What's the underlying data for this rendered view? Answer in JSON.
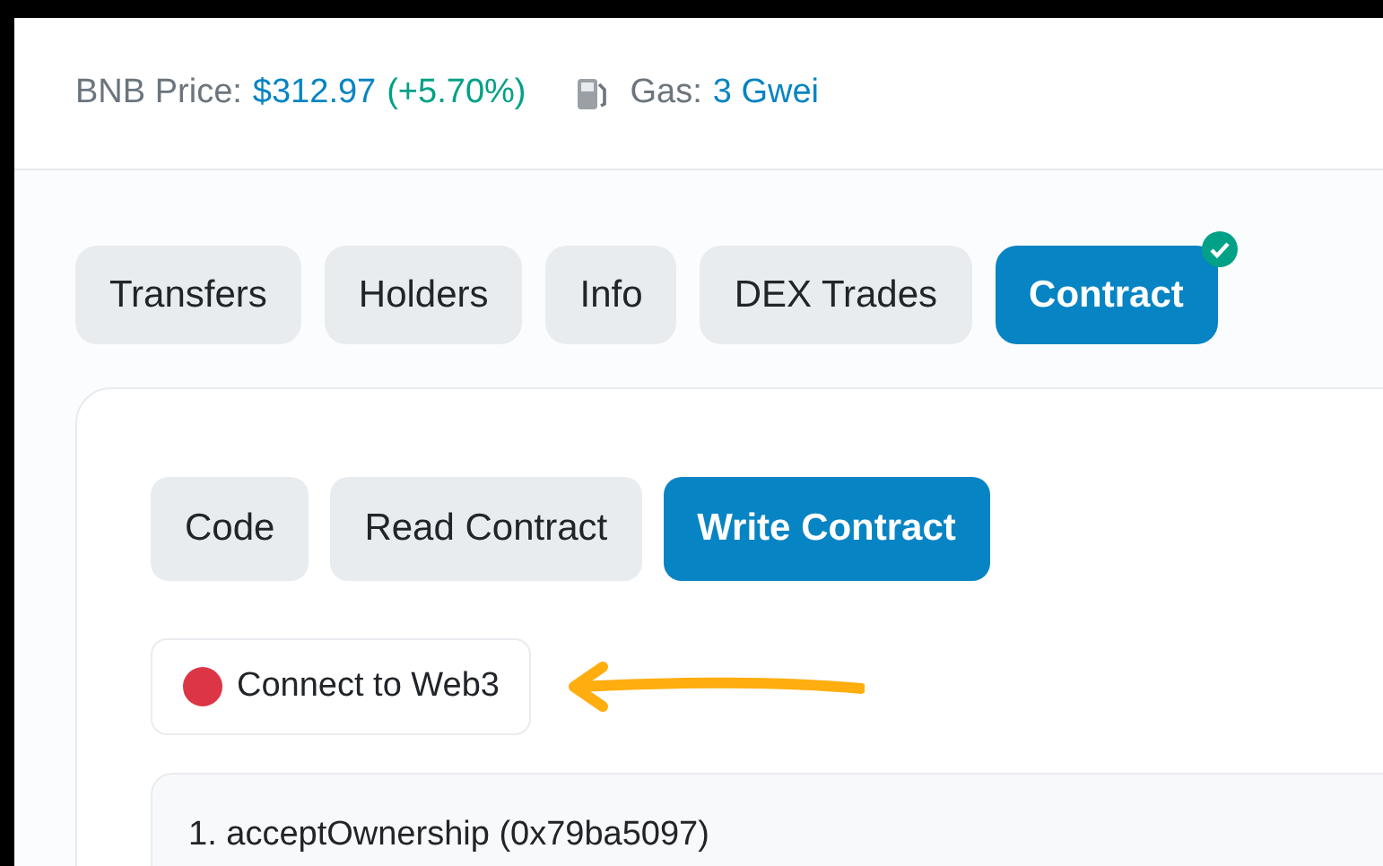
{
  "header": {
    "price_label": "BNB Price:",
    "price": "$312.97",
    "change": "(+5.70%)",
    "gas_label": "Gas:",
    "gas": "3 Gwei"
  },
  "tabs": [
    {
      "label": "Transfers",
      "selected": false,
      "verified": false
    },
    {
      "label": "Holders",
      "selected": false,
      "verified": false
    },
    {
      "label": "Info",
      "selected": false,
      "verified": false
    },
    {
      "label": "DEX Trades",
      "selected": false,
      "verified": false
    },
    {
      "label": "Contract",
      "selected": true,
      "verified": true
    }
  ],
  "subtabs": [
    {
      "label": "Code",
      "selected": false
    },
    {
      "label": "Read Contract",
      "selected": false
    },
    {
      "label": "Write Contract",
      "selected": true
    }
  ],
  "connect": {
    "label": "Connect to Web3",
    "connected": false
  },
  "functions": [
    {
      "label": "1. acceptOwnership (0x79ba5097)"
    }
  ]
}
